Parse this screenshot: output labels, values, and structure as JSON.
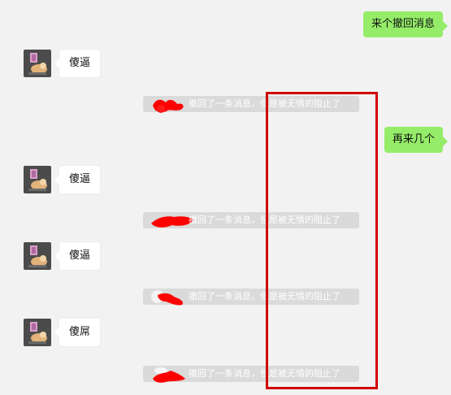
{
  "messages": {
    "self_1": "来个撤回消息",
    "self_2": "再来几个",
    "other_1": "傻逼",
    "other_2": "傻逼",
    "other_3": "傻逼",
    "other_4": "傻屌"
  },
  "recall_notice": "撤回了一条消息，但是被无情的阻止了",
  "colors": {
    "self_bubble": "#95ec69",
    "other_bubble": "#ffffff",
    "notice_bg": "#dadada",
    "redaction_scribble": "#ff0000",
    "highlight_border": "#d00000",
    "background": "#f2f2f2"
  },
  "icons": {
    "avatar": "avatar-image",
    "redaction": "red-scribble-redaction"
  }
}
